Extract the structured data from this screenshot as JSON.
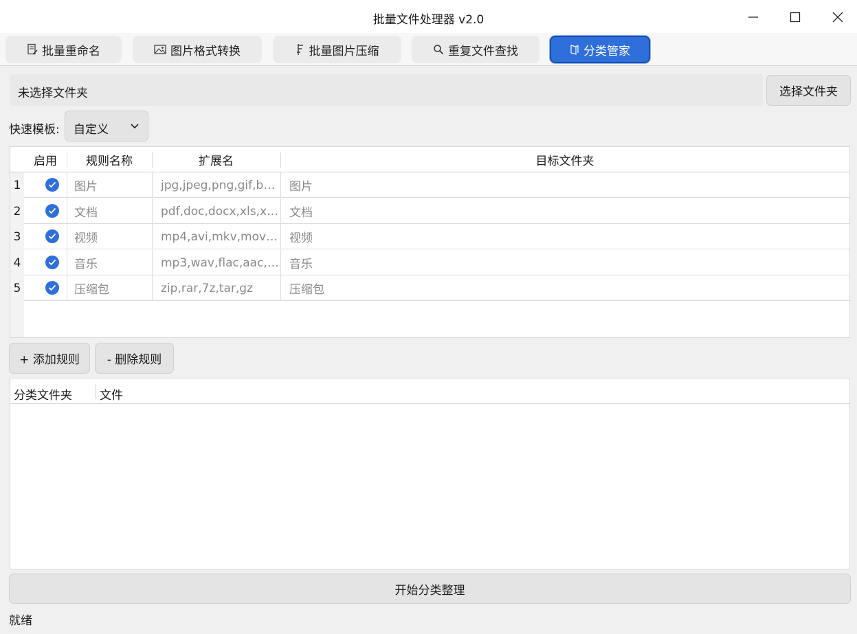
{
  "window": {
    "title": "批量文件处理器 v2.0",
    "controls": [
      "minimize-icon",
      "maximize-icon",
      "close-icon"
    ]
  },
  "tabs": [
    {
      "label": "批量重命名",
      "icon": "rename-doc-icon",
      "active": false
    },
    {
      "label": "图片格式转换",
      "icon": "image-icon",
      "active": false
    },
    {
      "label": "批量图片压缩",
      "icon": "compress-icon",
      "active": false
    },
    {
      "label": "重复文件查找",
      "icon": "search-icon",
      "active": false
    },
    {
      "label": "分类管家",
      "icon": "folder-icon",
      "active": true
    }
  ],
  "folder": {
    "path_text": "未选择文件夹",
    "select_button": "选择文件夹"
  },
  "template": {
    "label": "快速模板:",
    "selected": "自定义"
  },
  "rules_table": {
    "headers": [
      "启用",
      "规则名称",
      "扩展名",
      "目标文件夹"
    ],
    "rows": [
      {
        "num": "1",
        "enabled": true,
        "name": "图片",
        "ext": "jpg,jpeg,png,gif,b…",
        "target": "图片"
      },
      {
        "num": "2",
        "enabled": true,
        "name": "文档",
        "ext": "pdf,doc,docx,xls,x…",
        "target": "文档"
      },
      {
        "num": "3",
        "enabled": true,
        "name": "视频",
        "ext": "mp4,avi,mkv,mov…",
        "target": "视频"
      },
      {
        "num": "4",
        "enabled": true,
        "name": "音乐",
        "ext": "mp3,wav,flac,aac,…",
        "target": "音乐"
      },
      {
        "num": "5",
        "enabled": true,
        "name": "压缩包",
        "ext": "zip,rar,7z,tar,gz",
        "target": "压缩包"
      }
    ]
  },
  "rule_actions": {
    "add": "+ 添加规则",
    "delete": "- 删除规则"
  },
  "result_table": {
    "headers": [
      "分类文件夹",
      "文件"
    ]
  },
  "start_button": "开始分类整理",
  "status": "就绪",
  "colors": {
    "accent": "#2f6fdc",
    "background": "#f0f0f0"
  }
}
